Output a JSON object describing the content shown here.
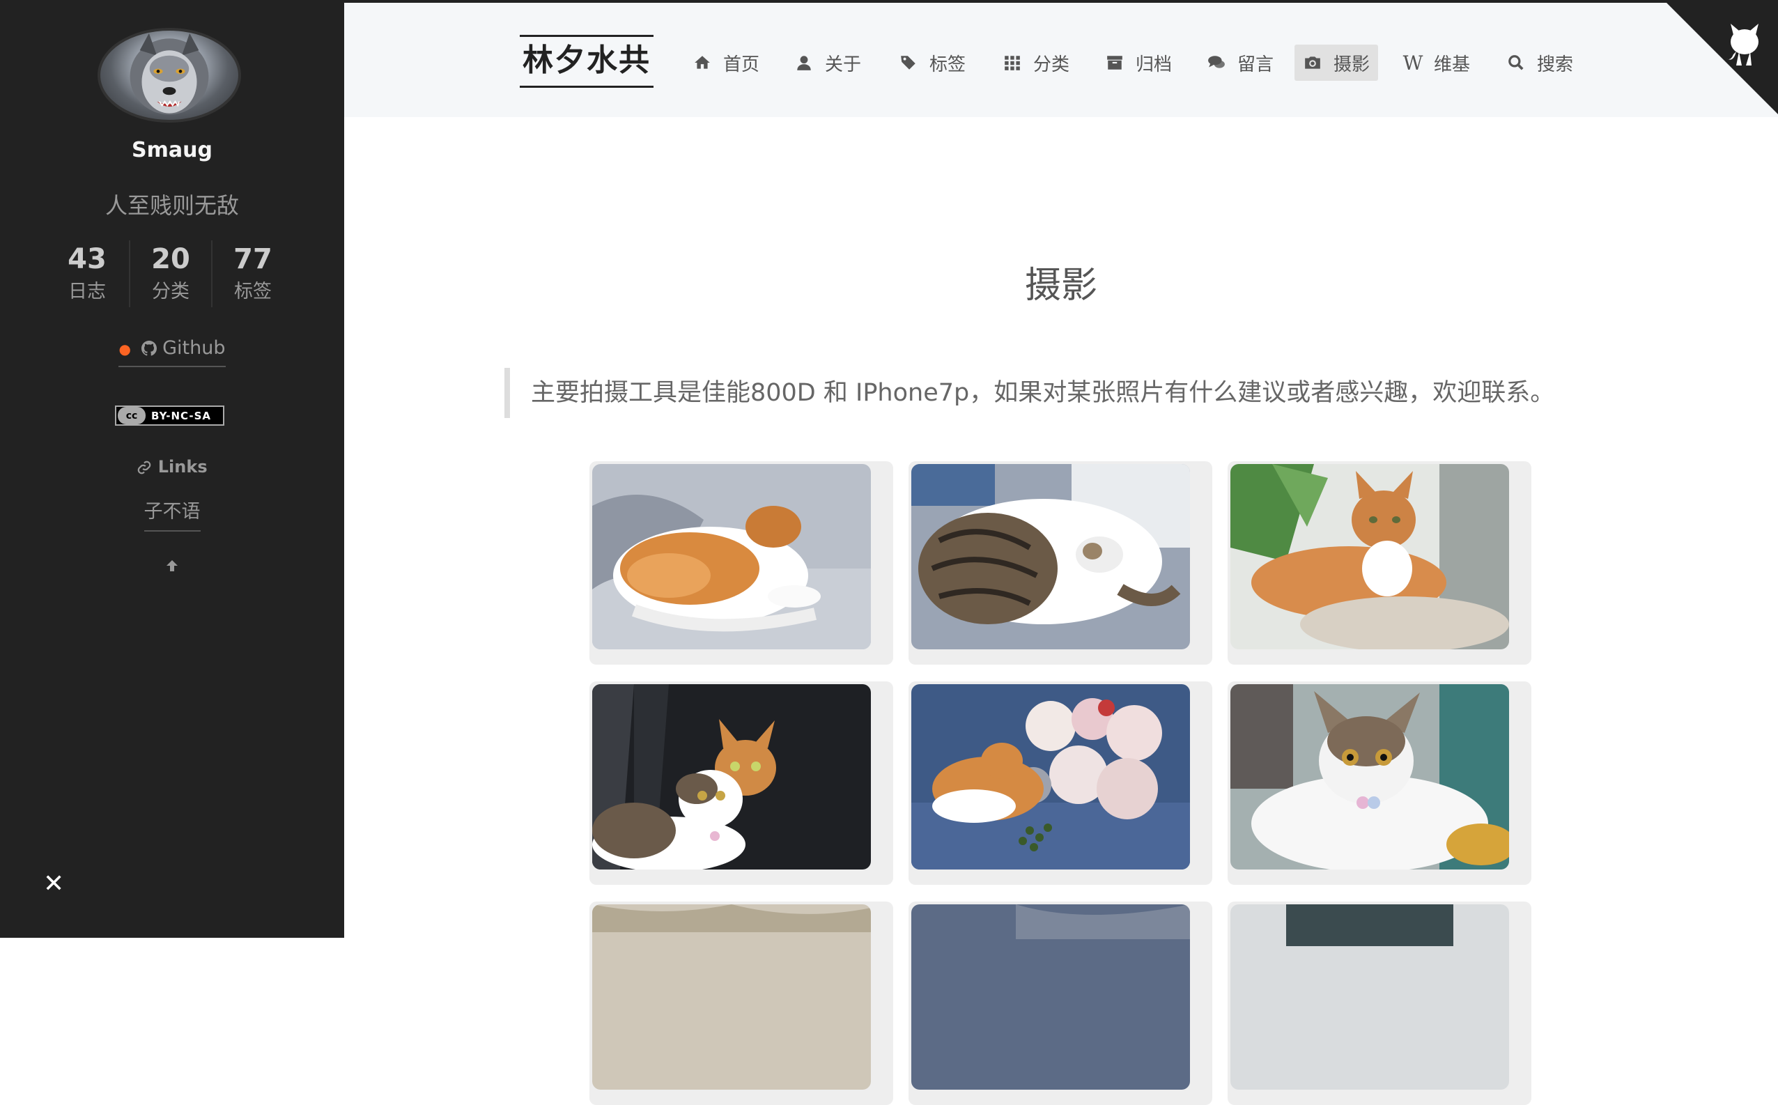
{
  "sidebar": {
    "author": "Smaug",
    "description": "人至贱则无敌",
    "stats": [
      {
        "count": "43",
        "label": "日志"
      },
      {
        "count": "20",
        "label": "分类"
      },
      {
        "count": "77",
        "label": "标签"
      }
    ],
    "github_label": "Github",
    "license_label": "BY-NC-SA",
    "license_cc": "cc",
    "links_title": "Links",
    "friend_link": "子不语",
    "back_to_top_icon": "arrow-up-icon",
    "close_icon": "close-icon"
  },
  "header": {
    "brand": "林夕水共",
    "menu": [
      {
        "label": "首页",
        "icon": "home-icon"
      },
      {
        "label": "关于",
        "icon": "user-icon"
      },
      {
        "label": "标签",
        "icon": "tags-icon"
      },
      {
        "label": "分类",
        "icon": "th-icon"
      },
      {
        "label": "归档",
        "icon": "archive-icon"
      },
      {
        "label": "留言",
        "icon": "comments-icon"
      },
      {
        "label": "摄影",
        "icon": "camera-icon",
        "active": true
      },
      {
        "label": "维基",
        "icon": "wikipedia-icon"
      },
      {
        "label": "搜索",
        "icon": "search-icon"
      }
    ],
    "corner_icon": "github-octocat-icon"
  },
  "main": {
    "title": "摄影",
    "quote": "主要拍摄工具是佳能800D 和 IPhone7p，如果对某张照片有什么建议或者感兴趣，欢迎联系。",
    "photos": [
      {
        "subject": "orange-white cat sleeping curled"
      },
      {
        "subject": "tabby-white cat sleeping on blanket"
      },
      {
        "subject": "orange-white cat lying near plant"
      },
      {
        "subject": "two cats in dark room"
      },
      {
        "subject": "orange cat with plush toys"
      },
      {
        "subject": "tabby-white cat portrait"
      },
      {
        "subject": "partial photo"
      },
      {
        "subject": "partial photo"
      },
      {
        "subject": "partial photo"
      }
    ]
  },
  "colors": {
    "sidebar_bg": "#222222",
    "header_bg": "#f5f7f9",
    "active_menu_bg": "#e1e1e1",
    "accent_dot": "#fc6423"
  }
}
